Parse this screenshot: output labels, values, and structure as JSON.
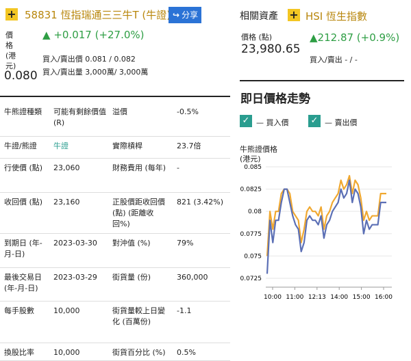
{
  "warrant": {
    "code_name": "58831 恆指瑞通三三牛T (牛證)",
    "share_label": "分享",
    "price_label": "價格(港元)",
    "price": "0.080",
    "change": "+0.017 (+27.0%)",
    "bid_ask_price": "買入/賣出價 0.081 / 0.082",
    "bid_ask_volume": "買入/賣出量 3,000萬/ 3,000萬"
  },
  "table": [
    {
      "l1": "牛熊證種類",
      "v1": "可能有剩餘價值 (R)",
      "l2": "溢價",
      "v2": "-0.5%"
    },
    {
      "l1": "牛證/熊證",
      "v1": "牛證",
      "l2": "實際槓桿",
      "v2": "23.7倍"
    },
    {
      "l1": "行使價 (點)",
      "v1": "23,060",
      "l2": "財務費用 (每年)",
      "v2": "-"
    },
    {
      "l1": "收回價 (點)",
      "v1": "23,160",
      "l2": "正股價距收回價 (點) (距離收回%)",
      "v2": "821 (3.42%)"
    },
    {
      "l1": "到期日 (年-月-日)",
      "v1": "2023-03-30",
      "l2": "對沖值 (%)",
      "v2": "79%"
    },
    {
      "l1": "最後交易日 (年-月-日)",
      "v1": "2023-03-29",
      "l2": "街貨量 (份)",
      "v2": "360,000"
    },
    {
      "l1": "每手股數",
      "v1": "10,000",
      "l2": "街貨量較上日變化 (百萬份)",
      "v2": "-1.1"
    },
    {
      "l1": "換股比率",
      "v1": "10,000",
      "l2": "街貨百分比 (%)",
      "v2": "0.5%"
    }
  ],
  "related": {
    "title": "相關資產",
    "name": "HSI 恆生指數",
    "price_label": "價格 (點)",
    "price": "23,980.65",
    "change": "212.87 (+0.9%)",
    "bid_ask": "買入/賣出 - / -"
  },
  "intraday": {
    "title": "即日價格走勢",
    "legend_bid": "— 買入價",
    "legend_ask": "— 賣出價",
    "chart_title": "牛熊證價格",
    "chart_unit": "(港元)"
  },
  "colors": {
    "accent_yellow": "#f3c623",
    "share_blue": "#2b73d6",
    "up_green": "#2e9e44",
    "teal": "#2a9d8f",
    "bid_line": "#5b6fb5",
    "ask_line": "#f0a830"
  },
  "chart_data": {
    "type": "line",
    "x_ticks": [
      "10:00",
      "11:00",
      "12:13",
      "14:00",
      "15:00",
      "16:00"
    ],
    "ylim": [
      0.0715,
      0.085
    ],
    "y_ticks": [
      0.085,
      0.0825,
      0.08,
      0.0775,
      0.075,
      0.0725
    ],
    "grid": "horizontal",
    "series": [
      {
        "name": "買入價",
        "color": "#5b6fb5",
        "values": [
          0.073,
          0.079,
          0.0765,
          0.079,
          0.079,
          0.081,
          0.0825,
          0.0825,
          0.081,
          0.0795,
          0.0785,
          0.078,
          0.0755,
          0.0765,
          0.079,
          0.0795,
          0.079,
          0.079,
          0.0785,
          0.0795,
          0.077,
          0.0785,
          0.079,
          0.08,
          0.0805,
          0.081,
          0.0825,
          0.0815,
          0.082,
          0.0835,
          0.081,
          0.0825,
          0.082,
          0.0805,
          0.0775,
          0.079,
          0.078,
          0.0785,
          0.0785,
          0.0785,
          0.081,
          0.081,
          0.081
        ]
      },
      {
        "name": "賣出價",
        "color": "#f0a830",
        "values": [
          0.075,
          0.08,
          0.078,
          0.08,
          0.08,
          0.082,
          0.0825,
          0.0825,
          0.082,
          0.08,
          0.0795,
          0.079,
          0.0765,
          0.078,
          0.08,
          0.0805,
          0.08,
          0.08,
          0.0795,
          0.0805,
          0.078,
          0.0795,
          0.08,
          0.081,
          0.0815,
          0.082,
          0.0835,
          0.0825,
          0.083,
          0.084,
          0.082,
          0.0835,
          0.083,
          0.0815,
          0.079,
          0.08,
          0.079,
          0.0795,
          0.0795,
          0.0795,
          0.082,
          0.082,
          0.082
        ]
      }
    ]
  }
}
